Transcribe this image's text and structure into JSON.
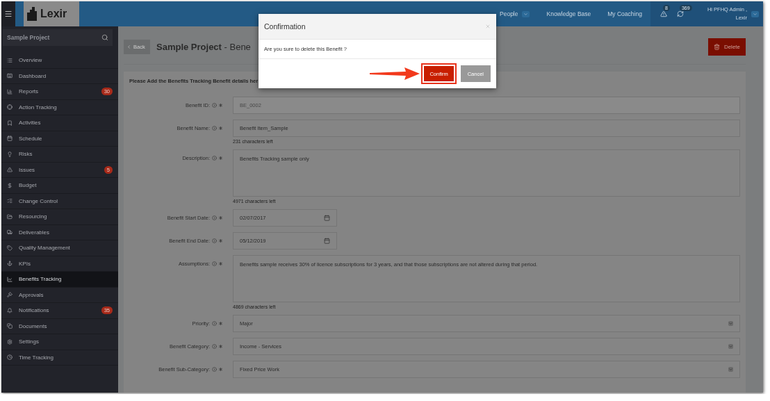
{
  "topbar": {
    "logo": "Lexir",
    "nav": [
      {
        "label": "People",
        "selected": false,
        "dropdown": true
      },
      {
        "label": "Knowledge Base",
        "selected": false,
        "dropdown": false
      },
      {
        "label": "My Coaching",
        "selected": false,
        "dropdown": false
      }
    ],
    "alerts": [
      {
        "count": "8"
      },
      {
        "count": "369"
      }
    ],
    "user": {
      "greeting": "Hi PFHQ Admin ,",
      "company": "Lexir"
    }
  },
  "sidebar": {
    "search": {
      "value": "Sample Project"
    },
    "items": [
      {
        "label": "Overview",
        "selected": false
      },
      {
        "label": "Dashboard",
        "selected": false
      },
      {
        "label": "Reports",
        "selected": false,
        "badge": "30"
      },
      {
        "label": "Action Tracking",
        "selected": false
      },
      {
        "label": "Activities",
        "selected": false
      },
      {
        "label": "Schedule",
        "selected": false
      },
      {
        "label": "Risks",
        "selected": false
      },
      {
        "label": "Issues",
        "selected": false,
        "badge": "5"
      },
      {
        "label": "Budget",
        "selected": false
      },
      {
        "label": "Change Control",
        "selected": false
      },
      {
        "label": "Resourcing",
        "selected": false
      },
      {
        "label": "Deliverables",
        "selected": false
      },
      {
        "label": "Quality Management",
        "selected": false
      },
      {
        "label": "KPIs",
        "selected": false
      },
      {
        "label": "Benefits Tracking",
        "selected": true
      },
      {
        "label": "Approvals",
        "selected": false
      },
      {
        "label": "Notifications",
        "selected": false,
        "badge": "35"
      },
      {
        "label": "Documents",
        "selected": false
      },
      {
        "label": "Settings",
        "selected": false
      },
      {
        "label": "Time Tracking",
        "selected": false
      }
    ]
  },
  "page": {
    "back": "Back",
    "title": "**Sample Project** - Bene",
    "delete": "Delete",
    "panel_heading": "Please Add the Benefits Tracking Benefit details her",
    "fields": [
      {
        "kind": "text",
        "label": "Benefit ID:",
        "value": "BE_0002",
        "disabled": true
      },
      {
        "kind": "text",
        "label": "Benefit Name:",
        "value": "Benefit Item_Sample",
        "counter": "231 characters left",
        "disabled": false
      },
      {
        "kind": "textarea",
        "label": "Description:",
        "value": "Benefits Tracking sample only",
        "counter": "4971 characters left",
        "disabled": false
      },
      {
        "kind": "date",
        "label": "Benefit Start Date:",
        "value": "02/07/2017",
        "disabled": false
      },
      {
        "kind": "date",
        "label": "Benefit End Date:",
        "value": "05/12/2019",
        "disabled": false
      },
      {
        "kind": "textarea",
        "label": "Assumptions:",
        "value": "Benefits sample receives 30% of licence subscriptions for 3 years, and that those subscriptions are not altered during that period.",
        "counter": "4869 characters left",
        "disabled": false
      },
      {
        "kind": "select",
        "label": "Priority:",
        "value": "Major",
        "disabled": false
      },
      {
        "kind": "select",
        "label": "Benefit Category:",
        "value": "Income - Services",
        "disabled": false
      },
      {
        "kind": "select",
        "label": "Benefit Sub-Category:",
        "value": "Fixed Price Work",
        "disabled": false
      }
    ]
  },
  "dialog": {
    "title": "Confirmation",
    "message": "Are you sure to delete this Benefit ?",
    "buttons": [
      {
        "kind": "primary",
        "label": "Confirm",
        "highlighted": true
      },
      {
        "kind": "secondary",
        "label": "Cancel",
        "highlighted": false
      }
    ]
  }
}
